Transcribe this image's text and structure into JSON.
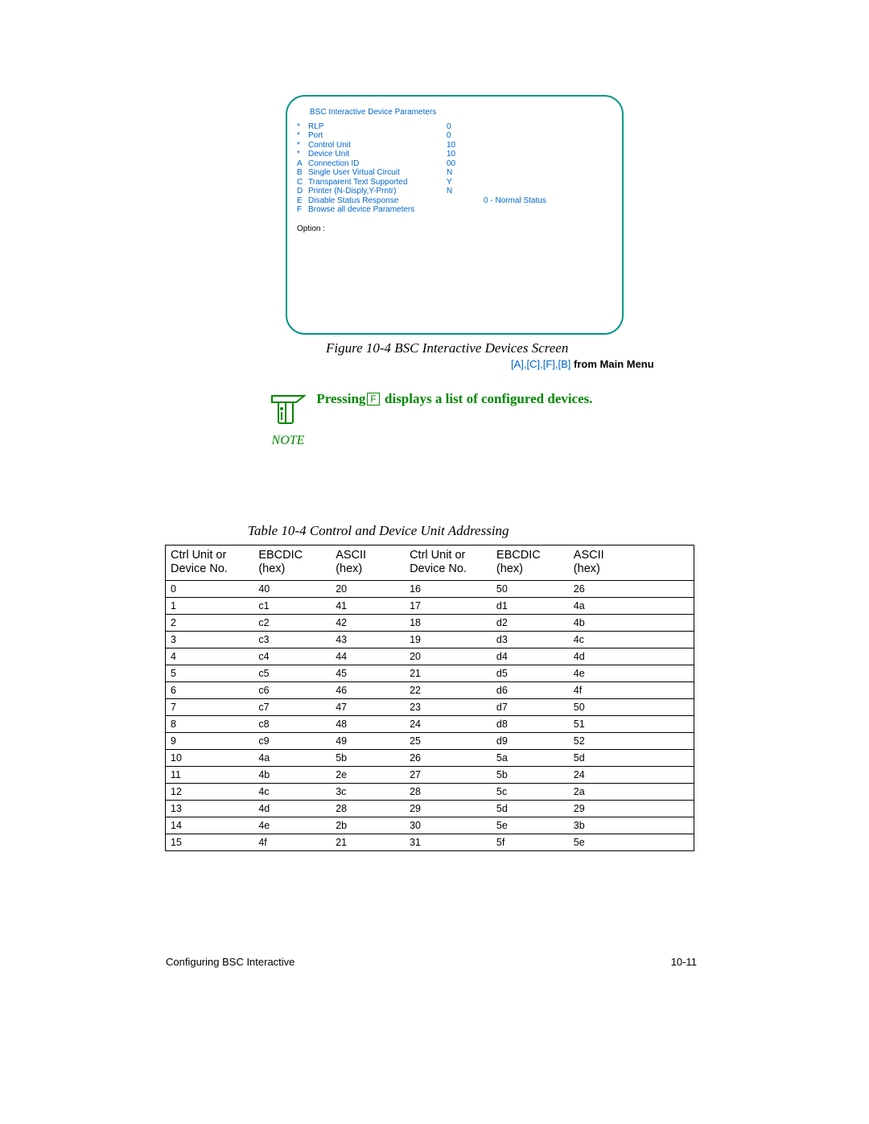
{
  "screen": {
    "title": "BSC Interactive Device Parameters",
    "params": [
      {
        "key": "*",
        "name": "RLP",
        "val": "0",
        "extra": ""
      },
      {
        "key": "*",
        "name": "Port",
        "val": "0",
        "extra": ""
      },
      {
        "key": "*",
        "name": "Control Unit",
        "val": "10",
        "extra": ""
      },
      {
        "key": "*",
        "name": "Device Unit",
        "val": "10",
        "extra": ""
      },
      {
        "key": "A",
        "name": "Connection ID",
        "val": "00",
        "extra": ""
      },
      {
        "key": "B",
        "name": "Single User Virtual Circuit",
        "val": "N",
        "extra": ""
      },
      {
        "key": "C",
        "name": "Transparent Text Supported",
        "val": " Y",
        "extra": ""
      },
      {
        "key": "D",
        "name": "Printer (N-Disply,Y-Prntr)",
        "val": "N",
        "extra": ""
      },
      {
        "key": "E",
        "name": "Disable Status Response",
        "val": "",
        "extra": "0 - Normal Status"
      },
      {
        "key": "F",
        "name": "Browse all device Parameters",
        "val": "",
        "extra": ""
      }
    ],
    "option_label": "Option :"
  },
  "figure_caption": "Figure 10-4    BSC Interactive Devices Screen",
  "breadcrumb": {
    "keys": "[A],[C],[F],[B]",
    "tail": "  from Main Menu"
  },
  "note": {
    "pre": "Pressing",
    "key": "F",
    "post": " displays a list of configured devices.",
    "label": "NOTE"
  },
  "table_caption": "Table 10-4    Control and Device Unit Addressing",
  "table": {
    "headers": [
      "Ctrl Unit or Device No.",
      "EBCDIC (hex)",
      "ASCII (hex)",
      "Ctrl Unit or Device No.",
      "EBCDIC (hex)",
      "ASCII (hex)"
    ],
    "header_lines": [
      [
        "Ctrl Unit or",
        "Device No."
      ],
      [
        "EBCDIC",
        "(hex)"
      ],
      [
        "ASCII",
        "(hex)"
      ],
      [
        "Ctrl Unit or",
        "Device No."
      ],
      [
        "EBCDIC",
        "(hex)"
      ],
      [
        "ASCII",
        "(hex)"
      ]
    ],
    "rows": [
      [
        "0",
        "40",
        "20",
        "16",
        "50",
        "26"
      ],
      [
        "1",
        "c1",
        "41",
        "17",
        "d1",
        "4a"
      ],
      [
        "2",
        "c2",
        "42",
        "18",
        "d2",
        "4b"
      ],
      [
        "3",
        "c3",
        "43",
        "19",
        "d3",
        "4c"
      ],
      [
        "4",
        "c4",
        "44",
        "20",
        "d4",
        "4d"
      ],
      [
        "5",
        "c5",
        "45",
        "21",
        "d5",
        "4e"
      ],
      [
        "6",
        "c6",
        "46",
        "22",
        "d6",
        "4f"
      ],
      [
        "7",
        "c7",
        "47",
        "23",
        "d7",
        "50"
      ],
      [
        "8",
        "c8",
        "48",
        "24",
        "d8",
        "51"
      ],
      [
        "9",
        "c9",
        "49",
        "25",
        "d9",
        "52"
      ],
      [
        "10",
        "4a",
        "5b",
        "26",
        "5a",
        "5d"
      ],
      [
        "11",
        "4b",
        "2e",
        "27",
        "5b",
        "24"
      ],
      [
        "12",
        "4c",
        "3c",
        "28",
        "5c",
        "2a"
      ],
      [
        "13",
        "4d",
        "28",
        "29",
        "5d",
        "29"
      ],
      [
        "14",
        "4e",
        "2b",
        "30",
        "5e",
        "3b"
      ],
      [
        "15",
        "4f",
        "21",
        "31",
        "5f",
        "5e"
      ]
    ]
  },
  "footer": {
    "left": "Configuring BSC Interactive",
    "right": "10-11"
  }
}
